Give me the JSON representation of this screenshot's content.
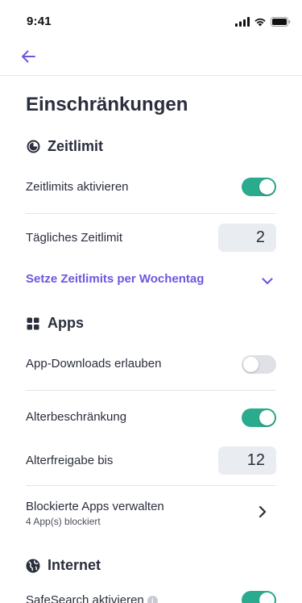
{
  "status_bar": {
    "time": "9:41"
  },
  "nav": {
    "back_icon": "arrow-left-icon"
  },
  "title": "Einschränkungen",
  "sections": {
    "zeitlimit": {
      "title": "Zeitlimit",
      "icon": "clock-pie-icon",
      "enable_label": "Zeitlimits aktivieren",
      "enable_on": true,
      "daily_label": "Tägliches Zeitlimit",
      "daily_value": "2",
      "weekday_link": "Setze Zeitlimits per Wochentag"
    },
    "apps": {
      "title": "Apps",
      "icon": "grid-icon",
      "downloads_label": "App-Downloads erlauben",
      "downloads_on": false,
      "age_restriction_label": "Alterbeschränkung",
      "age_restriction_on": true,
      "age_limit_label": "Alterfreigabe bis",
      "age_limit_value": "12",
      "blocked_label": "Blockierte Apps verwalten",
      "blocked_sub": "4 App(s) blockiert"
    },
    "internet": {
      "title": "Internet",
      "icon": "globe-icon",
      "safesearch_label": "SafeSearch aktivieren",
      "safesearch_on": true
    }
  },
  "colors": {
    "accent": "#6f56e0",
    "toggle_on": "#2bab8d",
    "toggle_off": "#dfe1e6",
    "text": "#2a2e3d"
  }
}
